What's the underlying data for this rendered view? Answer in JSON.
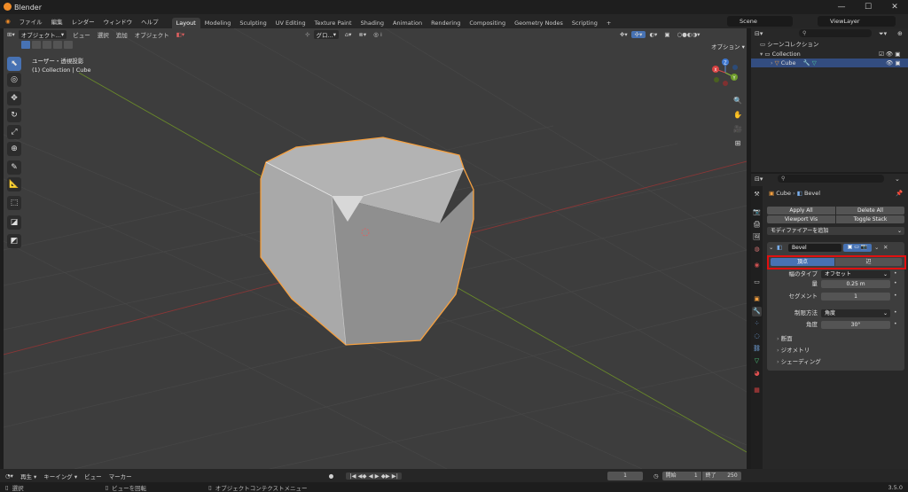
{
  "window": {
    "title": "Blender",
    "minimize": "—",
    "maximize": "☐",
    "close": "✕"
  },
  "menu": {
    "items": [
      "ファイル",
      "編集",
      "レンダー",
      "ウィンドウ",
      "ヘルプ"
    ],
    "workspaces": [
      "Layout",
      "Modeling",
      "Sculpting",
      "UV Editing",
      "Texture Paint",
      "Shading",
      "Animation",
      "Rendering",
      "Compositing",
      "Geometry Nodes",
      "Scripting"
    ],
    "active_workspace": "Layout",
    "add_tab": "+",
    "scene": "Scene",
    "view_layer": "ViewLayer"
  },
  "viewport": {
    "mode": "オブジェクト...",
    "menus": [
      "ビュー",
      "選択",
      "追加",
      "オブジェクト"
    ],
    "orientation": "グロ...",
    "options": "オプション",
    "overlay_line1": "ユーザー・透視投影",
    "overlay_line2": "(1) Collection | Cube",
    "gizmo": {
      "z": "Z",
      "y": "Y",
      "x": "X"
    }
  },
  "outliner": {
    "search_placeholder": "",
    "scene_collection": "シーンコレクション",
    "collection": "Collection",
    "cube": "Cube"
  },
  "properties": {
    "object": "Cube",
    "modifier_name_header": "Bevel",
    "apply_all": "Apply All",
    "delete_all": "Delete All",
    "viewport_vis": "Viewport Vis",
    "toggle_stack": "Toggle Stack",
    "add_modifier": "モディファイアーを追加",
    "modifier_name": "Bevel",
    "affect_vertices": "頂点",
    "affect_edges": "辺",
    "width_type_label": "幅のタイプ",
    "width_type_value": "オフセット",
    "amount_label": "量",
    "amount_value": "0.25 m",
    "segments_label": "セグメント",
    "segments_value": "1",
    "limit_method_label": "制限方法",
    "limit_method_value": "角度",
    "angle_label": "角度",
    "angle_value": "30°",
    "profile": "断面",
    "geometry": "ジオメトリ",
    "shading": "シェーディング"
  },
  "timeline": {
    "playback": "再生",
    "keying": "キーイング",
    "view": "ビュー",
    "marker": "マーカー",
    "current_frame": "1",
    "start_label": "開始",
    "start": "1",
    "end_label": "終了",
    "end": "250"
  },
  "status": {
    "select": "選択",
    "rotate": "ビューを回転",
    "context": "オブジェクトコンテクストメニュー",
    "version": "3.5.0"
  },
  "colors": {
    "accent": "#4772b3",
    "highlight": "#e01010",
    "selection": "#f5a040"
  }
}
